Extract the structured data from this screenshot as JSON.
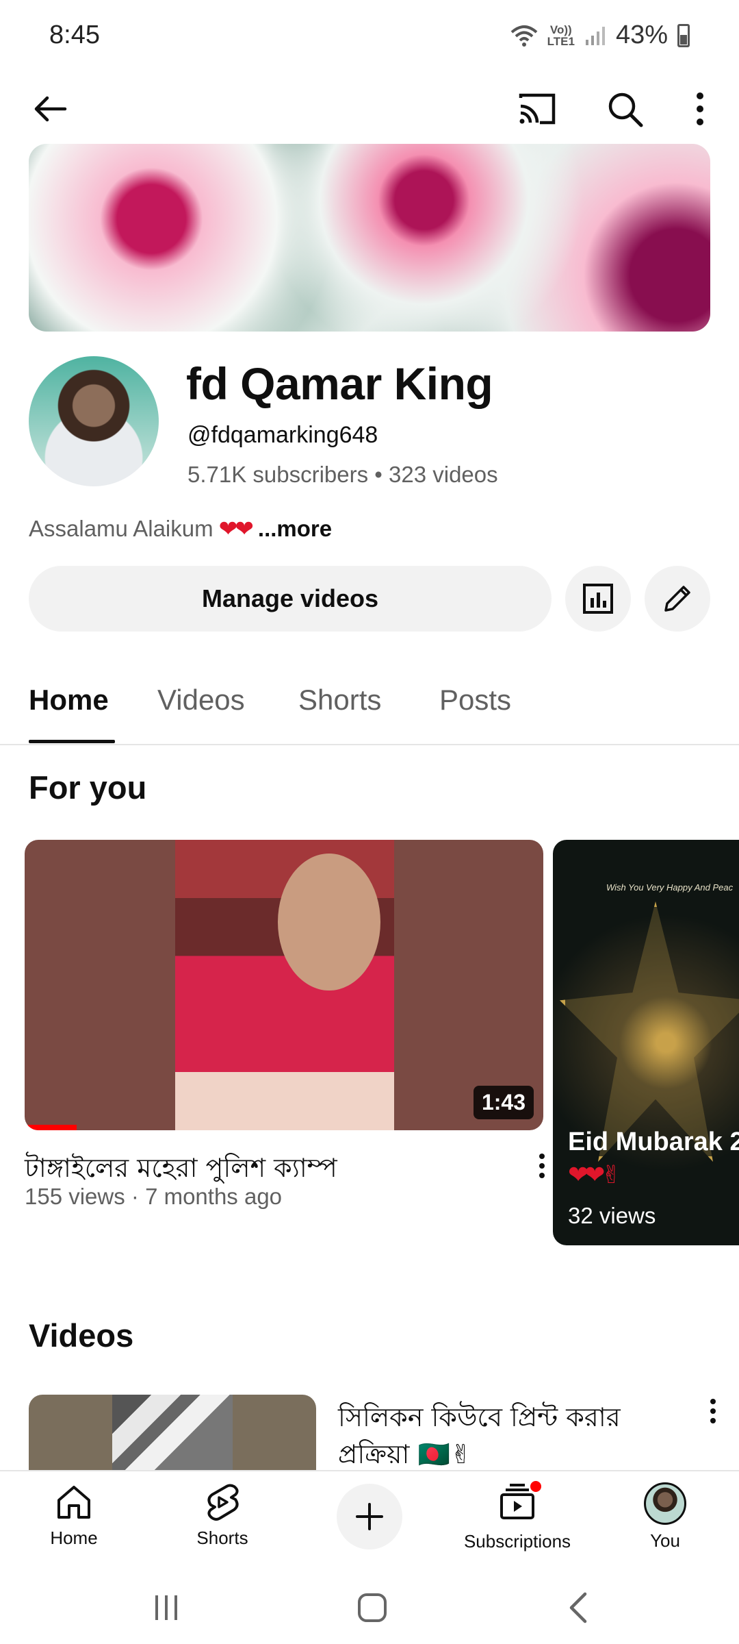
{
  "status_bar": {
    "time": "8:45",
    "network": "Vo))\nLTE1",
    "battery": "43%"
  },
  "app_bar": {
    "icons": [
      "back-arrow-icon",
      "cast-icon",
      "search-icon",
      "more-vert-icon"
    ]
  },
  "channel": {
    "name": "fd Qamar King",
    "handle": "@fdqamarking648",
    "stats": "5.71K subscribers • 323 videos",
    "description": "Assalamu Alaikum",
    "description_hearts": "❤❤",
    "more_label": "...more"
  },
  "actions": {
    "manage_label": "Manage videos",
    "analytics_icon": "analytics-icon",
    "edit_icon": "pencil-icon"
  },
  "tabs": [
    {
      "label": "Home",
      "active": true
    },
    {
      "label": "Videos",
      "active": false
    },
    {
      "label": "Shorts",
      "active": false
    },
    {
      "label": "Posts",
      "active": false
    }
  ],
  "for_you": {
    "title": "For you",
    "video": {
      "title": "টাঙ্গাইলের মহেরা পুলিশ ক্যাম্প",
      "meta": "155 views · 7 months ago",
      "duration": "1:43",
      "watched_fraction": 0.1
    },
    "short": {
      "greeting": "Wish You Very Happy And Peac",
      "title": "Eid Mubarak 2",
      "hearts": "❤❤✌",
      "views": "32 views"
    }
  },
  "videos_section": {
    "title": "Videos",
    "video": {
      "title": "সিলিকন কিউবে প্রিন্ট করার প্রক্রিয়া 🇧🇩✌"
    }
  },
  "bottom_nav": [
    {
      "label": "Home",
      "icon": "home-icon"
    },
    {
      "label": "Shorts",
      "icon": "shorts-icon"
    },
    {
      "label": "",
      "icon": "plus-icon"
    },
    {
      "label": "Subscriptions",
      "icon": "subscriptions-icon"
    },
    {
      "label": "You",
      "icon": "avatar-icon"
    }
  ],
  "colors": {
    "accent_red": "#ff0000",
    "text_primary": "#0f0f0f",
    "text_secondary": "#606060",
    "chip_bg": "#f2f2f2"
  }
}
